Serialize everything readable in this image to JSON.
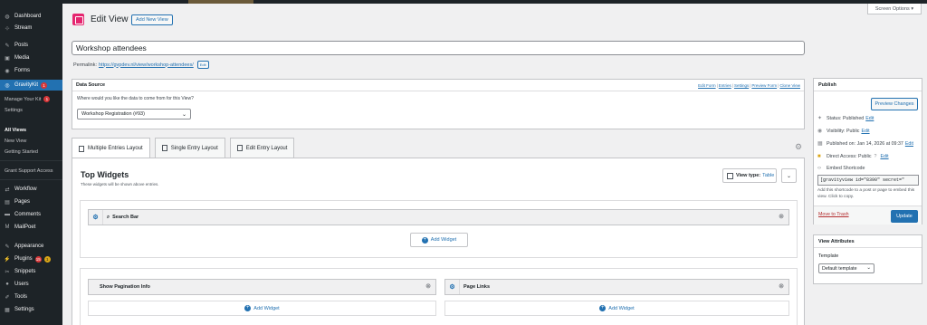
{
  "sidebar": {
    "items": [
      {
        "label": "Dashboard",
        "icon": "dashboard-icon",
        "glyph": "◍"
      },
      {
        "label": "Stream",
        "icon": "stream-icon",
        "glyph": "⊹"
      },
      {
        "label": "Posts",
        "icon": "pin-icon",
        "glyph": "✎"
      },
      {
        "label": "Media",
        "icon": "media-icon",
        "glyph": "▣"
      },
      {
        "label": "Forms",
        "icon": "forms-icon",
        "glyph": "◉"
      },
      {
        "label": "GravityKit",
        "icon": "gravitykit-icon",
        "glyph": "◎",
        "badge": "1"
      },
      {
        "label": "Workflow",
        "icon": "workflow-icon",
        "glyph": "⇄"
      },
      {
        "label": "Pages",
        "icon": "pages-icon",
        "glyph": "▤"
      },
      {
        "label": "Comments",
        "icon": "comments-icon",
        "glyph": "▬"
      },
      {
        "label": "MailPoet",
        "icon": "mailpoet-icon",
        "glyph": "M"
      },
      {
        "label": "Appearance",
        "icon": "appearance-icon",
        "glyph": "✎"
      },
      {
        "label": "Plugins",
        "icon": "plugins-icon",
        "glyph": "⚡",
        "badge": "15",
        "badge2": "1"
      },
      {
        "label": "Snippets",
        "icon": "snippets-icon",
        "glyph": "✂"
      },
      {
        "label": "Users",
        "icon": "users-icon",
        "glyph": "●"
      },
      {
        "label": "Tools",
        "icon": "tools-icon",
        "glyph": "✐"
      },
      {
        "label": "Settings",
        "icon": "settings-icon",
        "glyph": "▦"
      }
    ],
    "submenu": {
      "manage_kit": "Manage Your Kit",
      "manage_kit_badge": "1",
      "settings": "Settings",
      "all_views": "All Views",
      "new_view": "New View",
      "getting_started": "Getting Started",
      "grant_support": "Grant Support Access"
    }
  },
  "header": {
    "screen_options": "Screen Options ▾",
    "title": "Edit View",
    "add_new": "Add New View"
  },
  "post": {
    "title": "Workshop attendees",
    "permalink_label": "Permalink:",
    "permalink_url": "https://gvpdev.nl/view/workshop-attendees/",
    "edit_label": "Edit"
  },
  "data_source": {
    "title": "Data Source",
    "links": [
      "Edit Form",
      "Entries",
      "Settings",
      "Preview Form",
      "Clone View"
    ],
    "question": "Where would you like the data to come from for this View?",
    "selected_form": "Workshop Registration (#93)"
  },
  "tabs": [
    "Multiple Entries Layout",
    "Single Entry Layout",
    "Edit Entry Layout"
  ],
  "widgets": {
    "title": "Top Widgets",
    "subtitle": "These widgets will be shown above entries.",
    "view_type_label": "View type:",
    "view_type_value": "Table",
    "search_bar": "Search Bar",
    "add_widget": "Add Widget",
    "pagination_info": "Show Pagination Info",
    "page_links": "Page Links"
  },
  "publish": {
    "title": "Publish",
    "preview": "Preview Changes",
    "status_label": "Status:",
    "status_value": "Published",
    "visibility_label": "Visibility:",
    "visibility_value": "Public",
    "published_label": "Published on:",
    "published_value": "Jan 14, 2026 at 09:37",
    "direct_access_label": "Direct Access:",
    "direct_access_value": "Public",
    "edit": "Edit",
    "embed_label": "Embed Shortcode",
    "shortcode": "[gravityview id=\"8390\" secret=\"",
    "shortcode_help": "Add this shortcode to a post or page to embed this view. Click to copy.",
    "trash": "Move to Trash",
    "update": "Update"
  },
  "view_attributes": {
    "title": "View Attributes",
    "template_label": "Template",
    "template_value": "Default template"
  }
}
